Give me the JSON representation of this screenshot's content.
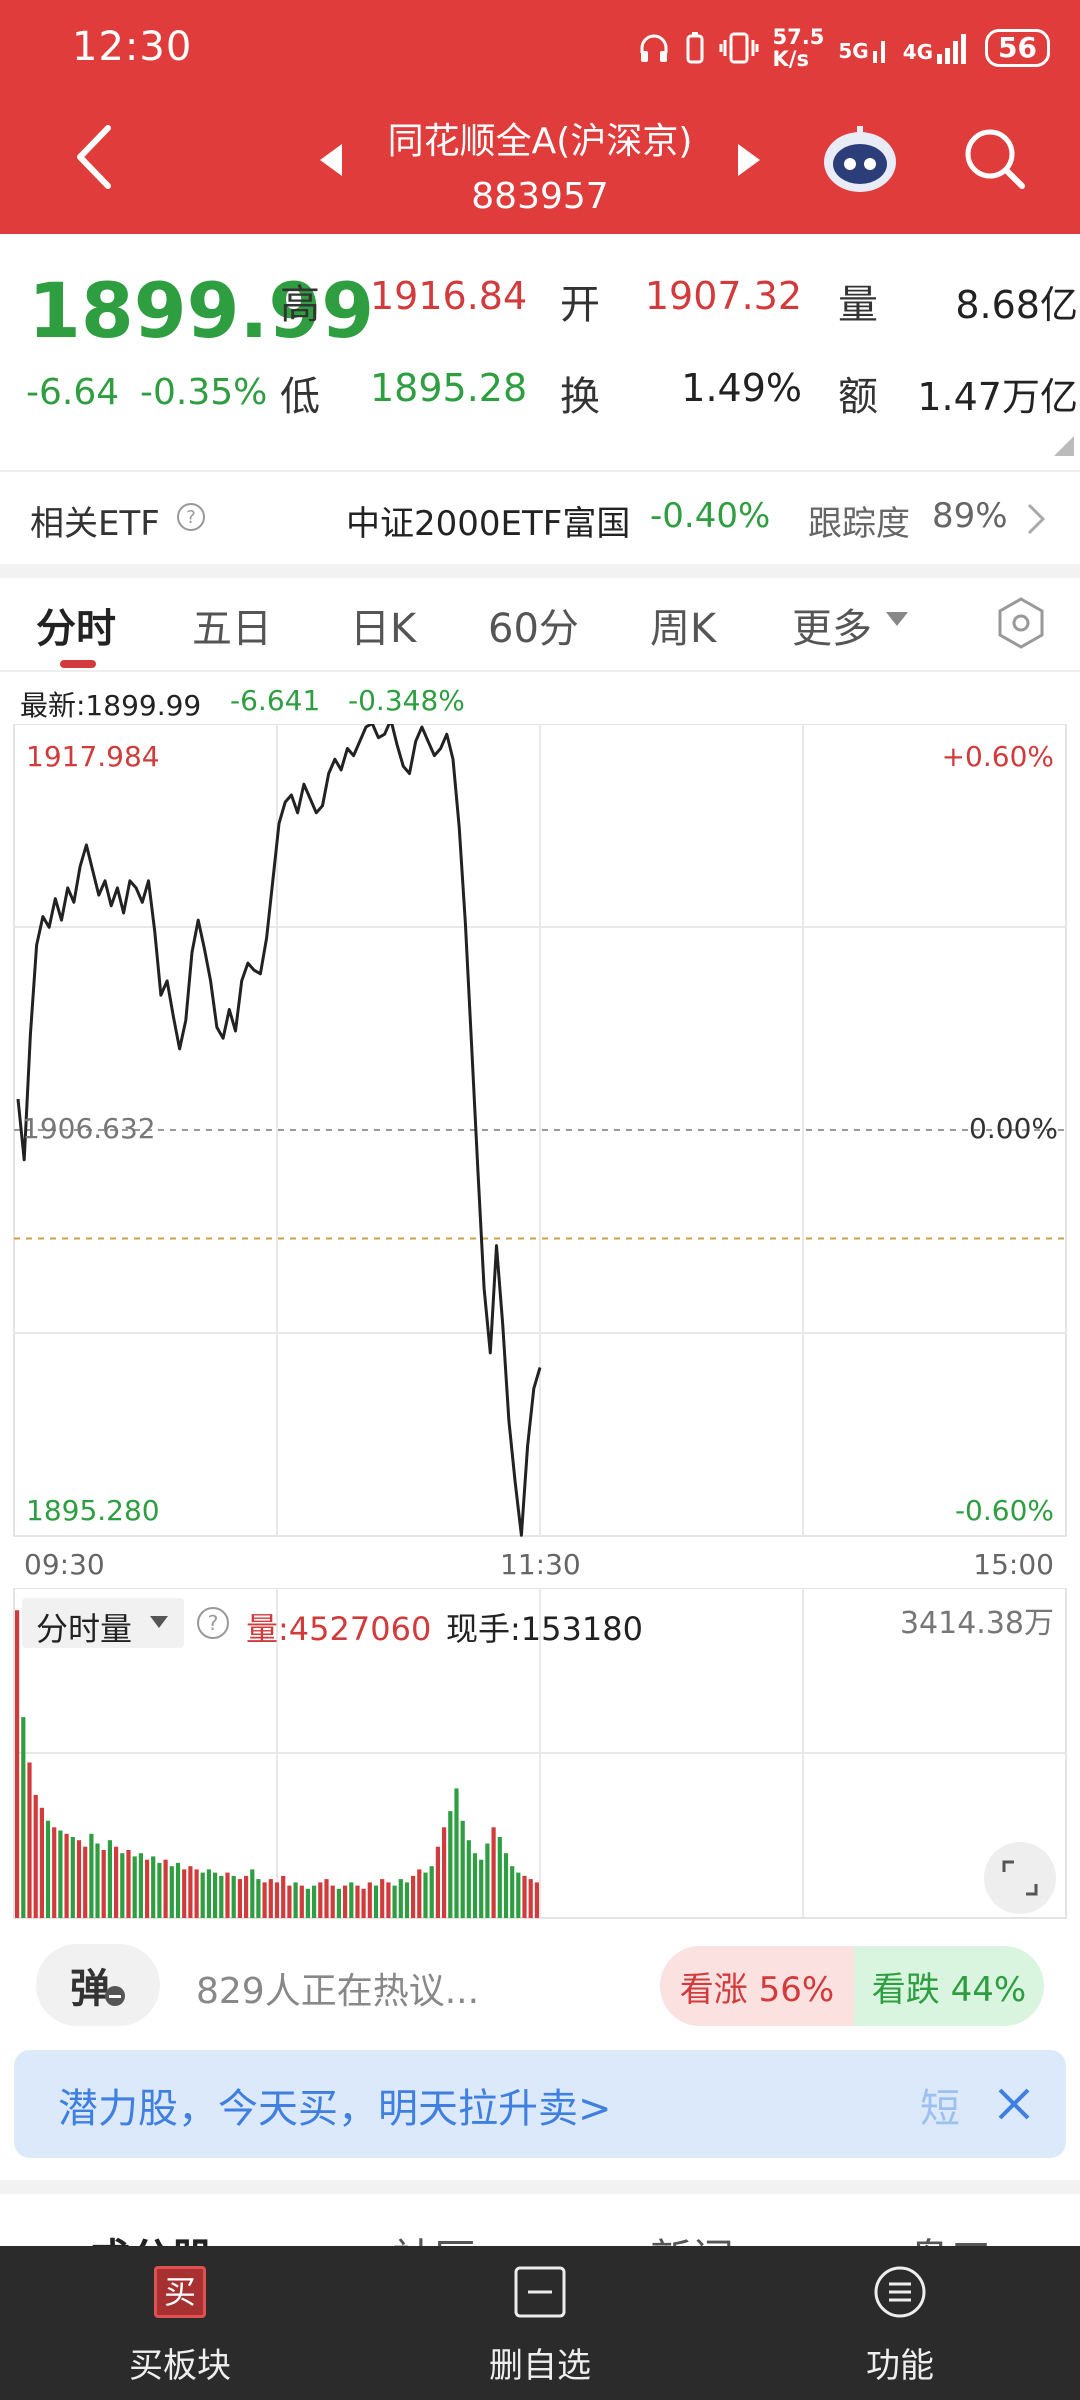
{
  "status_bar": {
    "time": "12:30",
    "net_speed_top": "57.5",
    "net_speed_bottom": "K/s",
    "network_5g": "5G",
    "network_4g": "4G",
    "battery": "56"
  },
  "header": {
    "title": "同花顺全A(沪深京)",
    "code": "883957",
    "icons": [
      "back-arrow-icon",
      "prev-triangle-icon",
      "next-triangle-icon",
      "robot-assistant-icon",
      "search-icon"
    ]
  },
  "quote": {
    "price": "1899.99",
    "change": "-6.64",
    "change_pct": "-0.35%",
    "high_label": "高",
    "high": "1916.84",
    "open_label": "开",
    "open": "1907.32",
    "volume_label": "量",
    "volume": "8.68亿",
    "low_label": "低",
    "low": "1895.28",
    "turnover_label": "换",
    "turnover": "1.49%",
    "amount_label": "额",
    "amount": "1.47万亿"
  },
  "etf": {
    "label": "相关ETF",
    "name": "中证2000ETF富国",
    "change": "-0.40%",
    "tracking_label": "跟踪度",
    "tracking": "89%"
  },
  "tabs": [
    "分时",
    "五日",
    "日K",
    "60分",
    "周K",
    "更多"
  ],
  "chart_info": {
    "latest_label": "最新:1899.99",
    "latest_change": "-6.641",
    "latest_pct": "-0.348%"
  },
  "chart_data": {
    "type": "line",
    "y_max_label": "1917.984",
    "y_mid_label": "1906.632",
    "y_min_label": "1895.280",
    "pct_max_label": "+0.60%",
    "pct_mid_label": "0.00%",
    "pct_min_label": "-0.60%",
    "x_ticks": [
      "09:30",
      "11:30",
      "15:00"
    ],
    "ylim": [
      1895.28,
      1917.984
    ],
    "prev_close": 1906.632,
    "avg_line": 1903.6,
    "series": [
      {
        "values": [
          1907.5,
          1905.8,
          1909.3,
          1911.8,
          1912.6,
          1912.3,
          1913.1,
          1912.5,
          1913.4,
          1913.0,
          1914.0,
          1914.6,
          1913.9,
          1913.2,
          1913.6,
          1912.9,
          1913.4,
          1912.7,
          1913.6,
          1913.4,
          1913.0,
          1913.6,
          1912.2,
          1910.4,
          1910.8,
          1909.8,
          1908.9,
          1909.7,
          1911.6,
          1912.5,
          1911.7,
          1910.8,
          1909.5,
          1909.2,
          1910.0,
          1909.4,
          1910.8,
          1911.3,
          1911.1,
          1911.0,
          1912.0,
          1913.6,
          1915.2,
          1915.8,
          1916.0,
          1915.5,
          1916.3,
          1915.9,
          1915.5,
          1915.7,
          1916.6,
          1917.0,
          1916.7,
          1917.3,
          1917.1,
          1917.5,
          1917.9,
          1918.0,
          1917.6,
          1917.7,
          1918.1,
          1917.4,
          1916.8,
          1916.6,
          1917.5,
          1917.9,
          1917.5,
          1917.1,
          1917.3,
          1917.7,
          1917.0,
          1915.1,
          1912.4,
          1909.0,
          1905.5,
          1902.2,
          1900.4,
          1903.4,
          1901.2,
          1898.5,
          1896.8,
          1895.3,
          1897.8,
          1899.4,
          1899.99
        ]
      }
    ],
    "volume": {
      "label": "分时量",
      "qty_label": "量:4527060",
      "hand_label": "现手:153180",
      "max_label": "3414.38万",
      "bars": [
        95,
        62,
        48,
        38,
        34,
        30,
        28,
        27,
        26,
        25,
        24,
        22,
        26,
        23,
        21,
        24,
        22,
        20,
        21,
        19,
        20,
        18,
        19,
        17,
        18,
        16,
        17,
        15,
        16,
        15,
        14,
        15,
        14,
        13,
        14,
        13,
        12,
        13,
        15,
        12,
        11,
        12,
        11,
        13,
        10,
        11,
        10,
        9,
        10,
        11,
        12,
        10,
        9,
        10,
        11,
        10,
        9,
        11,
        10,
        12,
        11,
        10,
        12,
        11,
        13,
        15,
        14,
        16,
        22,
        28,
        33,
        40,
        30,
        24,
        20,
        18,
        23,
        28,
        25,
        20,
        16,
        14,
        13,
        12,
        11
      ],
      "ylim": [
        0,
        100
      ]
    }
  },
  "sentiment": {
    "danmu_label": "弹",
    "discussing": "829人正在热议...",
    "up_label": "看涨 56%",
    "down_label": "看跌 44%"
  },
  "banner": {
    "text": "潜力股，今天买，明天拉升卖>",
    "right_text": "短"
  },
  "lower_tabs": [
    "成分股",
    "社区",
    "新闻",
    "盘口"
  ],
  "bottom_nav": [
    {
      "label": "买板块",
      "icon": "buy-icon",
      "icon_text": "买"
    },
    {
      "label": "删自选",
      "icon": "remove-watchlist-icon"
    },
    {
      "label": "功能",
      "icon": "menu-icon"
    }
  ],
  "colors": {
    "header_red": "#e03c3c",
    "up_red": "#d23b3b",
    "down_green": "#2e9e41",
    "line": "#222222"
  }
}
